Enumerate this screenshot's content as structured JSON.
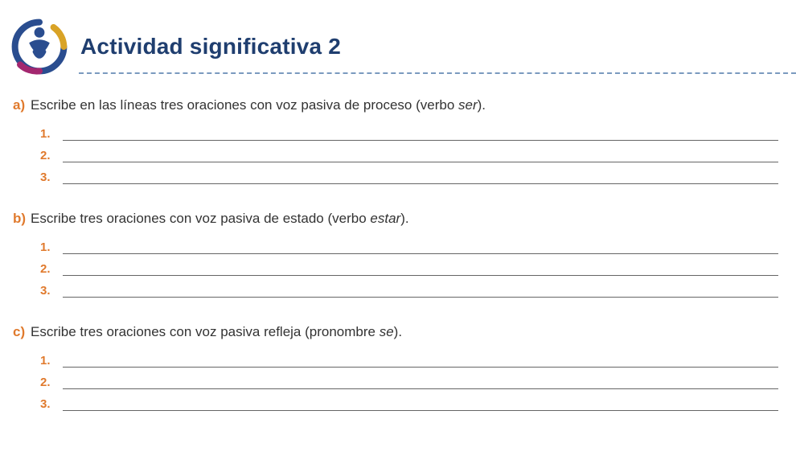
{
  "header": {
    "title": "Actividad significativa 2"
  },
  "sections": [
    {
      "letter": "a)",
      "prompt_pre": "Escribe en las líneas tres oraciones con voz pasiva de proceso (verbo ",
      "prompt_em": "ser",
      "prompt_post": ").",
      "lines": [
        "1.",
        "2.",
        "3."
      ]
    },
    {
      "letter": "b)",
      "prompt_pre": "Escribe tres oraciones con voz pasiva de estado (verbo ",
      "prompt_em": "estar",
      "prompt_post": ").",
      "lines": [
        "1.",
        "2.",
        "3."
      ]
    },
    {
      "letter": "c)",
      "prompt_pre": "Escribe tres oraciones con voz pasiva refleja (pronombre ",
      "prompt_em": "se",
      "prompt_post": ").",
      "lines": [
        "1.",
        "2.",
        "3."
      ]
    }
  ]
}
